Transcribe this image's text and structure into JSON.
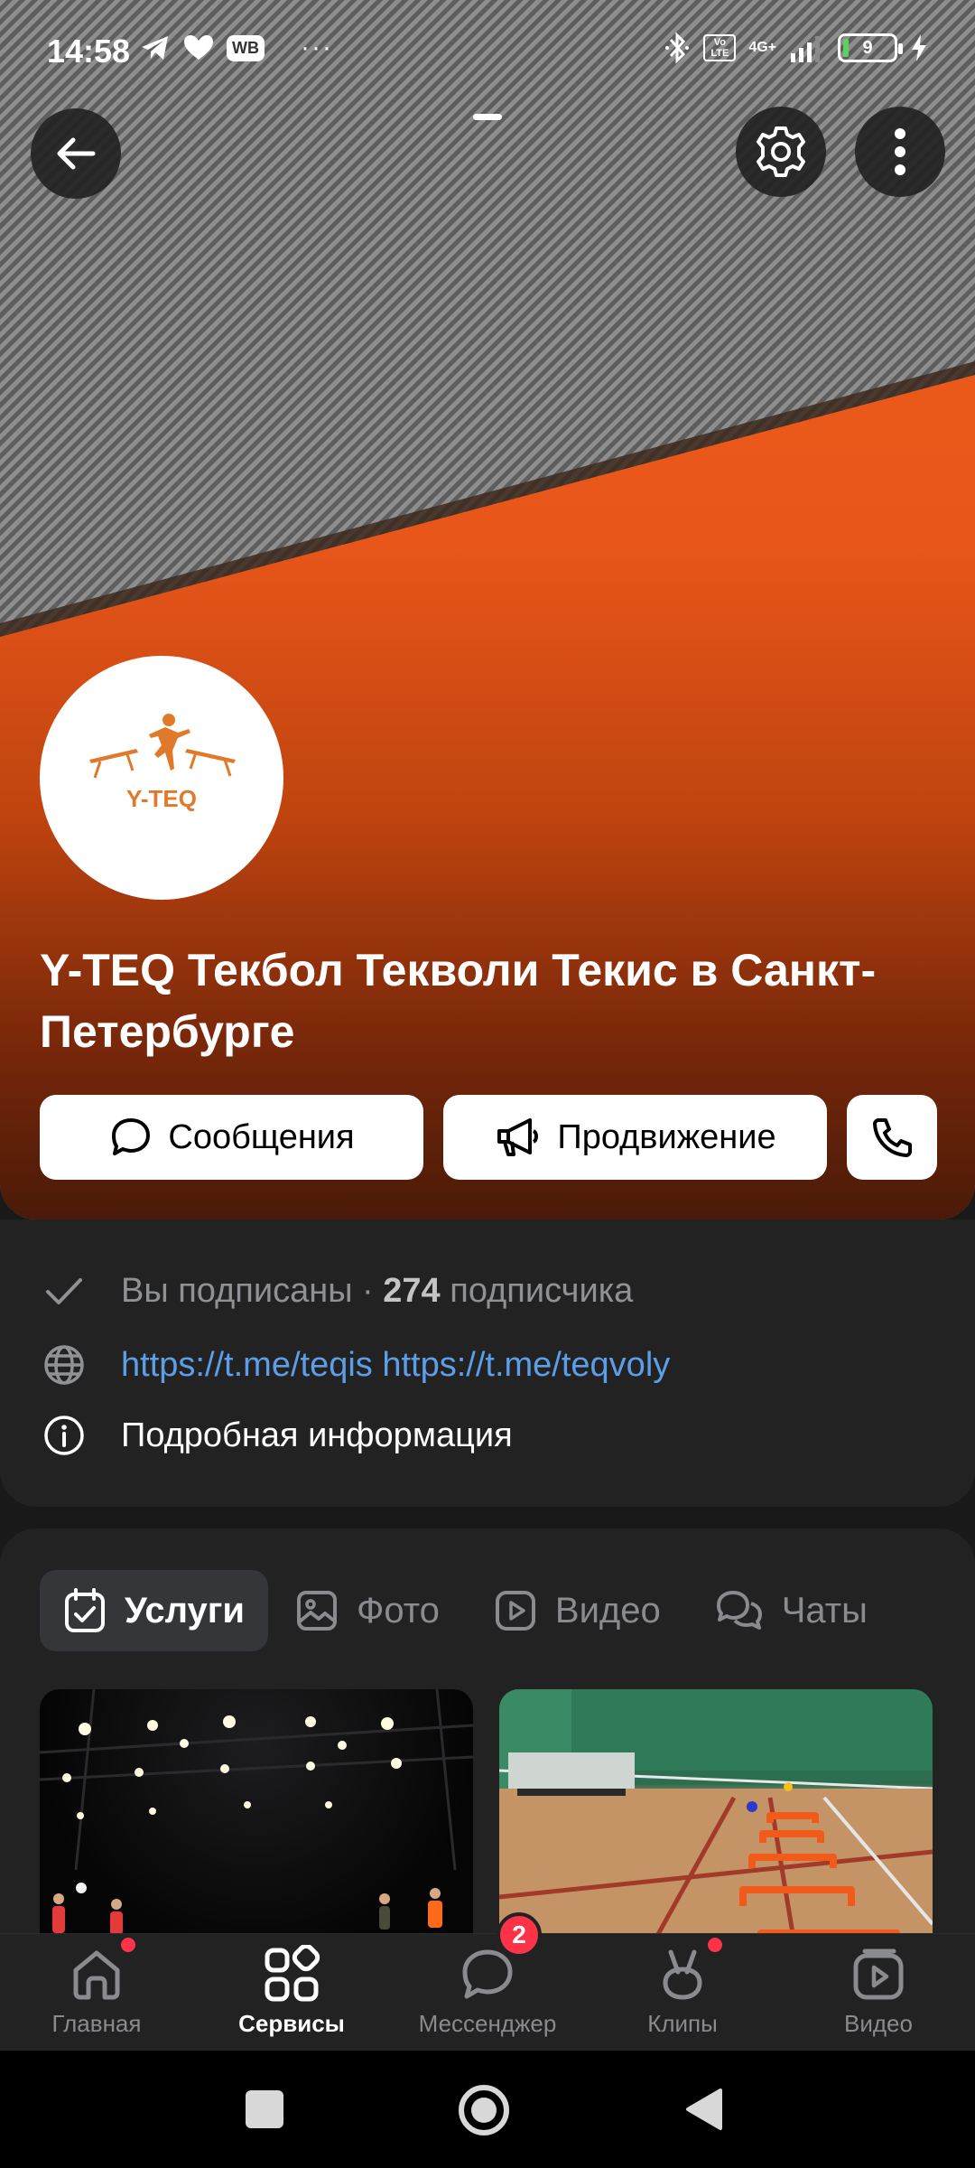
{
  "status_bar": {
    "time": "14:58",
    "wb_label": "WB",
    "more_label": "···",
    "network_label": "4G+",
    "lte_label": "Vo LTE",
    "battery_level": "9"
  },
  "header": {
    "back_icon": "arrow-left-icon",
    "settings_icon": "gear-icon",
    "more_icon": "more-vertical-icon"
  },
  "community": {
    "logo_text": "Y-TEQ",
    "title": "Y-TEQ Текбол Текволи Текис в Санкт-Петербурге",
    "colors": {
      "cover_orange": "#e8561a",
      "cover_gray": "#8e8e8e"
    }
  },
  "actions": {
    "messages_label": "Сообщения",
    "promotion_label": "Продвижение",
    "call_icon": "phone-icon"
  },
  "info": {
    "subscribed_label": "Вы подписаны",
    "separator": " · ",
    "subscribers_count": "274",
    "subscribers_label": " подписчика",
    "links": "https://t.me/teqis https://t.me/teqvoly",
    "details_label": "Подробная информация"
  },
  "tabs": [
    {
      "label": "Услуги",
      "icon": "calendar-check-icon",
      "active": true
    },
    {
      "label": "Фото",
      "icon": "image-icon",
      "active": false
    },
    {
      "label": "Видео",
      "icon": "play-icon",
      "active": false
    },
    {
      "label": "Чаты",
      "icon": "chats-icon",
      "active": false
    }
  ],
  "bottom_nav": [
    {
      "label": "Главная",
      "icon": "home-icon",
      "dot": true
    },
    {
      "label": "Сервисы",
      "icon": "services-icon",
      "active": true
    },
    {
      "label": "Мессенджер",
      "icon": "message-icon",
      "badge": "2"
    },
    {
      "label": "Клипы",
      "icon": "clips-icon",
      "dot": true
    },
    {
      "label": "Видео",
      "icon": "video-icon"
    }
  ]
}
